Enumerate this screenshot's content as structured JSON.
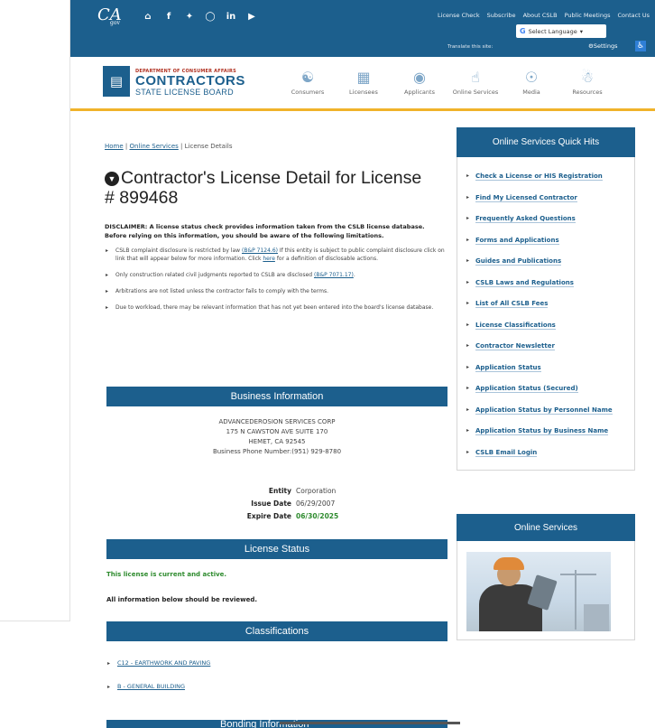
{
  "topbar": {
    "ca_logo": "CA",
    "ca_logo_sub": "gov",
    "links": [
      "License Check",
      "Subscribe",
      "About CSLB",
      "Public Meetings",
      "Contact Us"
    ],
    "translate_label": "Translate this site:",
    "language_label": "Select Language",
    "settings_label": "Settings"
  },
  "logo": {
    "dept": "DEPARTMENT OF CONSUMER AFFAIRS",
    "name": "CONTRACTORS",
    "sub": "STATE LICENSE BOARD"
  },
  "nav": [
    "Consumers",
    "Licensees",
    "Applicants",
    "Online Services",
    "Media",
    "Resources"
  ],
  "breadcrumb": {
    "home": "Home",
    "online": "Online Services",
    "current": "License Details",
    "sep": " | "
  },
  "page": {
    "title_1": "Contractor's License Detail for License",
    "title_2": "# 899468",
    "disclaimer": "DISCLAIMER: A license status check provides information taken from the CSLB license database. Before relying on this information, you should be aware of the following limitations.",
    "bullet1_a": "CSLB complaint disclosure is restricted by law ",
    "bullet1_link": "(B&P 7124.6)",
    "bullet1_b": " If this entity is subject to public complaint disclosure click on link that will appear below for more information. Click ",
    "bullet1_here": "here",
    "bullet1_c": " for a definition of disclosable actions.",
    "bullet2_a": "Only construction related civil judgments reported to CSLB are disclosed ",
    "bullet2_link": "(B&P 7071.17)",
    "bullet2_b": ".",
    "bullet3": "Arbitrations are not listed unless the contractor fails to comply with the terms.",
    "bullet4": "Due to workload, there may be relevant information that has not yet been entered into the board's license database."
  },
  "business": {
    "heading": "Business Information",
    "name": "ADVANCEDEROSION SERVICES CORP",
    "address1": "175 N CAWSTON AVE SUITE 170",
    "address2": "HEMET, CA 92545",
    "phone": "Business Phone Number:(951) 929-8780",
    "entity_label": "Entity",
    "entity": "Corporation",
    "issue_label": "Issue Date",
    "issue": "06/29/2007",
    "expire_label": "Expire Date",
    "expire": "06/30/2025"
  },
  "status": {
    "heading": "License Status",
    "active": "This license is current and active.",
    "review": "All information below should be reviewed."
  },
  "classifications": {
    "heading": "Classifications",
    "items": [
      "C12 - EARTHWORK AND PAVING",
      "B - GENERAL BUILDING"
    ]
  },
  "next_heading": "Bonding Information",
  "quick_hits": {
    "heading": "Online Services Quick Hits",
    "links": [
      "Check a License or HIS Registration",
      "Find My Licensed Contractor",
      "Frequently Asked Questions",
      "Forms and Applications",
      "Guides and Publications",
      "CSLB Laws and Regulations",
      "List of All CSLB Fees",
      "License Classifications",
      "Contractor Newsletter",
      "Application Status",
      "Application Status (Secured)",
      "Application Status by Personnel Name",
      "Application Status by Business Name",
      "CSLB Email Login"
    ]
  },
  "online_services": {
    "heading": "Online Services"
  }
}
